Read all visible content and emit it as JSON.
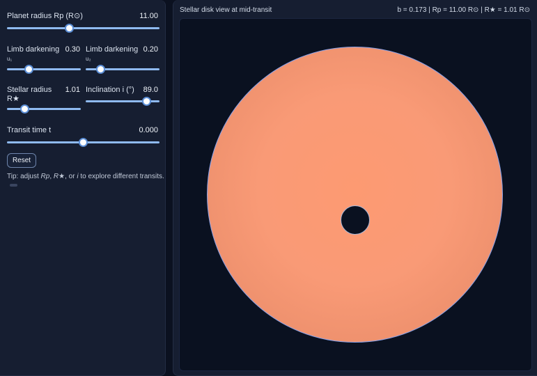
{
  "controls": {
    "planet_radius": {
      "label": "Planet radius Rp (R⊙)",
      "value": "11.00",
      "fraction": 0.41
    },
    "u1": {
      "label": "Limb darkening",
      "sub": "u₁",
      "value": "0.30",
      "fraction": 0.3
    },
    "u2": {
      "label": "Limb darkening",
      "sub": "u₂",
      "value": "0.20",
      "fraction": 0.2
    },
    "stellar_radius": {
      "label": "Stellar radius",
      "label2": "R★",
      "value": "1.01",
      "fraction": 0.24
    },
    "inclination": {
      "label": "Inclination i (°)",
      "value": "89.0",
      "fraction": 0.83
    },
    "transit_time": {
      "label": "Transit time t",
      "value": "0.000",
      "fraction": 0.5
    },
    "reset_label": "Reset",
    "tip": {
      "prefix": "Tip: adjust ",
      "rp": "Rp",
      "sep1": ", ",
      "rstar": "R★",
      "sep2": ", or ",
      "i": "i",
      "suffix": " to explore different transits."
    }
  },
  "viewer": {
    "title": "Stellar disk view at mid-transit",
    "stats": "b = 0.173 | Rp = 11.00 R⊙ | R★ = 1.01 R⊙"
  },
  "colors": {
    "star": "#f99a76",
    "star_outline": "#8aa2e8",
    "slider_track": "#8fbaf0",
    "background": "#0b1120"
  }
}
